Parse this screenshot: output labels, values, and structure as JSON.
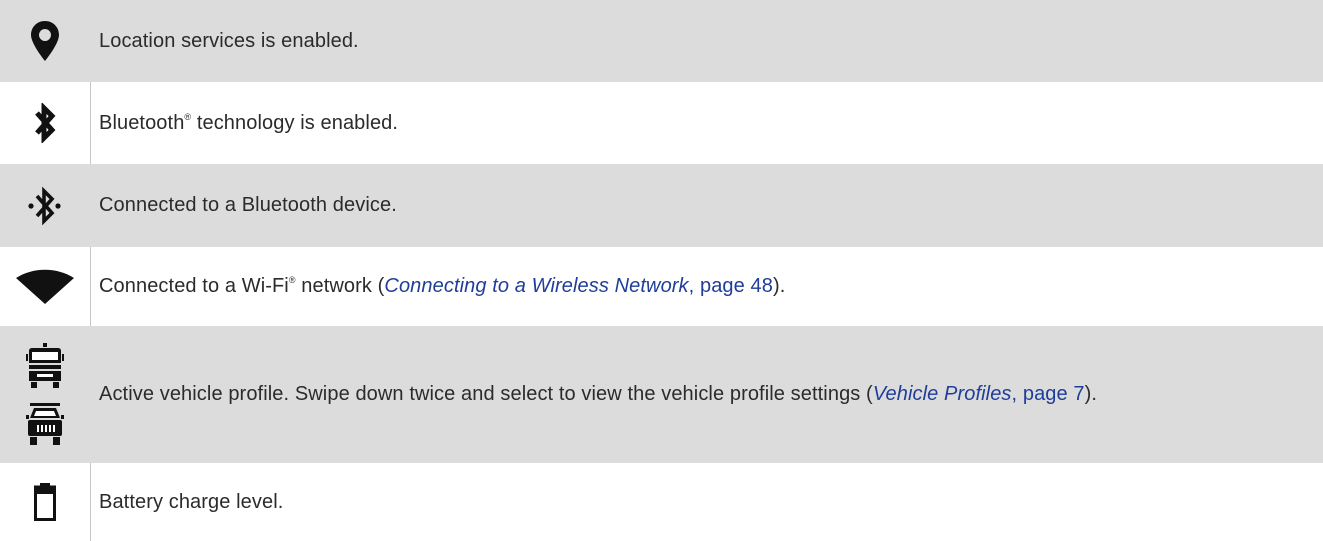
{
  "rows": [
    {
      "icon": "location-pin-icon",
      "text": "Location services is enabled."
    },
    {
      "icon": "bluetooth-icon",
      "text_prefix": "Bluetooth",
      "text_sup": "®",
      "text_suffix": " technology is enabled."
    },
    {
      "icon": "bluetooth-connected-icon",
      "text": "Connected to a Bluetooth device."
    },
    {
      "icon": "wifi-icon",
      "text_prefix": "Connected to a Wi-Fi",
      "text_sup": "®",
      "text_middle": " network (",
      "link_italic": "Connecting to a Wireless Network",
      "link_plain": ", page 48",
      "text_suffix": ")."
    },
    {
      "icon": "vehicle-profile-icons",
      "text_prefix": "Active vehicle profile. Swipe down twice and select to view the vehicle profile settings (",
      "link_italic": "Vehicle Profiles",
      "link_plain": ", page 7",
      "text_suffix": ")."
    },
    {
      "icon": "battery-icon",
      "text": "Battery charge level."
    }
  ],
  "colors": {
    "shade": "#dcdcdc",
    "text": "#2b2b2b",
    "link": "#1f3d99",
    "icon": "#111111"
  }
}
